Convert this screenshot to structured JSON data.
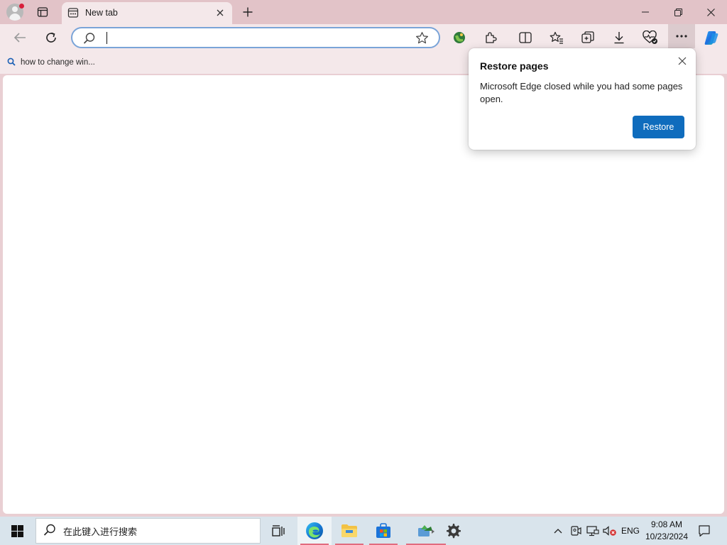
{
  "browser": {
    "tab": {
      "title": "New tab"
    },
    "omnibox": {
      "value": "",
      "placeholder": ""
    },
    "favorites": [
      {
        "label": "how to change win..."
      }
    ]
  },
  "restore_popup": {
    "title": "Restore pages",
    "message": "Microsoft Edge closed while you had some pages open.",
    "button_label": "Restore"
  },
  "taskbar": {
    "search_text": "在此键入进行搜索",
    "language": "ENG",
    "time": "9:08 AM",
    "date": "10/23/2024"
  },
  "colors": {
    "accent": "#0f6cbd",
    "titlebar": "#e2c3c8",
    "toolbar": "#f4e8ea",
    "taskbar": "#d9e4ec",
    "notification_dot": "#d81e3a"
  }
}
